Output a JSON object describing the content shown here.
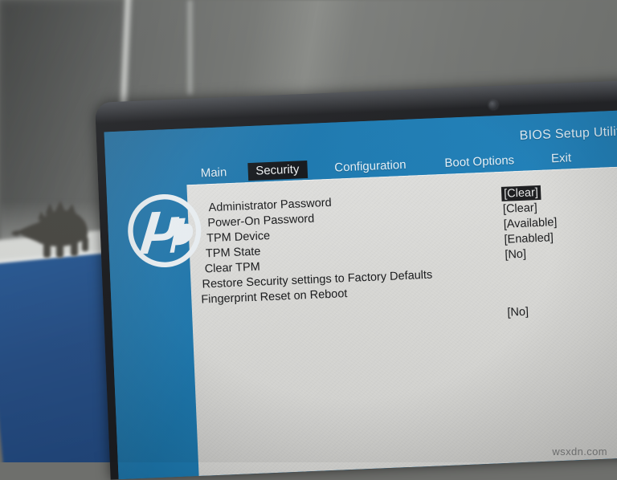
{
  "scene": {
    "description": "photo-of-laptop-bios-screen",
    "objects": {
      "wall_label": "office wall",
      "desk_label": "desk edge",
      "figurine_label": "stegosaurus figurine",
      "webcam_label": "webcam"
    }
  },
  "screen": {
    "brand_logo": "hp-logo",
    "title": "BIOS Setup Utility",
    "accent_blue": "#1d7cb4",
    "panel_bg": "#dedddb",
    "highlight_bg": "#17181a",
    "text_color": "#17181a"
  },
  "menubar": {
    "tabs": [
      {
        "label": "Main",
        "selected": false
      },
      {
        "label": "Security",
        "selected": true
      },
      {
        "label": "Configuration",
        "selected": false
      },
      {
        "label": "Boot Options",
        "selected": false
      },
      {
        "label": "Exit",
        "selected": false
      }
    ]
  },
  "settings": {
    "rows": [
      {
        "label": "Administrator Password",
        "value": "[Clear]",
        "selected": true,
        "indent": 26,
        "value_offset": 0
      },
      {
        "label": "Power-On Password",
        "value": "[Clear]",
        "selected": false,
        "indent": 24,
        "value_offset": 0
      },
      {
        "label": "TPM Device",
        "value": "[Available]",
        "selected": false,
        "indent": 22,
        "value_offset": 0
      },
      {
        "label": "TPM State",
        "value": "[Enabled]",
        "selected": false,
        "indent": 20,
        "value_offset": 0
      },
      {
        "label": "Clear TPM",
        "value": "[No]",
        "selected": false,
        "indent": 18,
        "value_offset": 0
      },
      {
        "label": "Restore Security settings to Factory Defaults",
        "value": "",
        "selected": false,
        "indent": 14,
        "value_offset": 0
      },
      {
        "label": "Fingerprint Reset on Reboot",
        "value": "[No]",
        "selected": false,
        "indent": 12,
        "value_offset": 34
      }
    ]
  },
  "watermark": {
    "text": "wsxdn.com"
  }
}
